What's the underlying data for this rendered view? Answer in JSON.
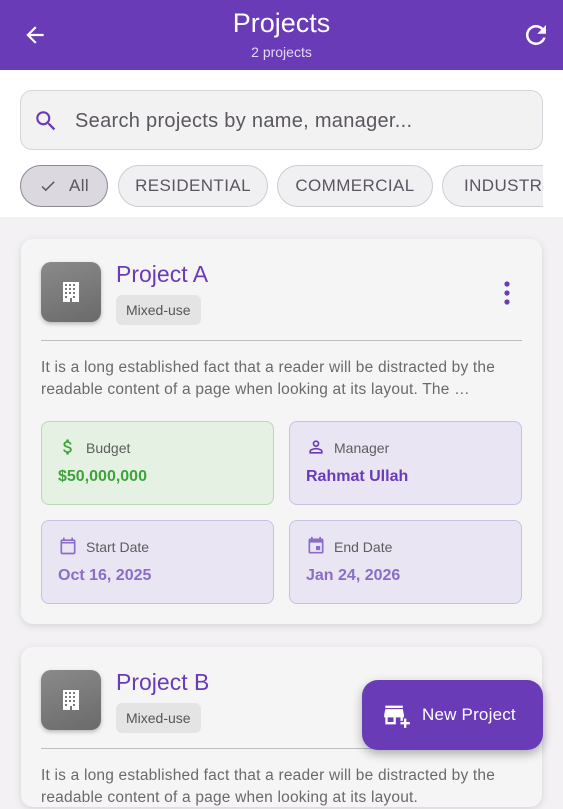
{
  "appbar": {
    "title": "Projects",
    "subtitle": "2 projects"
  },
  "search": {
    "placeholder": "Search projects by name, manager..."
  },
  "filters": [
    {
      "label": "All",
      "selected": true
    },
    {
      "label": "RESIDENTIAL",
      "selected": false
    },
    {
      "label": "COMMERCIAL",
      "selected": false
    },
    {
      "label": "INDUSTRIAL",
      "selected": false
    }
  ],
  "projects": [
    {
      "name": "Project A",
      "tag": "Mixed-use",
      "description": "It is a long established fact that a reader will be distracted by the readable content of a page when looking at its layout. The …",
      "budget_label": "Budget",
      "budget_value": "$50,000,000",
      "manager_label": "Manager",
      "manager_value": "Rahmat Ullah",
      "start_label": "Start Date",
      "start_value": "Oct 16, 2025",
      "end_label": "End Date",
      "end_value": "Jan 24, 2026"
    },
    {
      "name": "Project B",
      "tag": "Mixed-use",
      "description": "It is a long established fact that a reader will be distracted by the readable content of a page when looking at its layout."
    }
  ],
  "fab": {
    "label": "New Project"
  },
  "colors": {
    "primary": "#6a3bb7",
    "budget_green": "#3ea33b"
  }
}
